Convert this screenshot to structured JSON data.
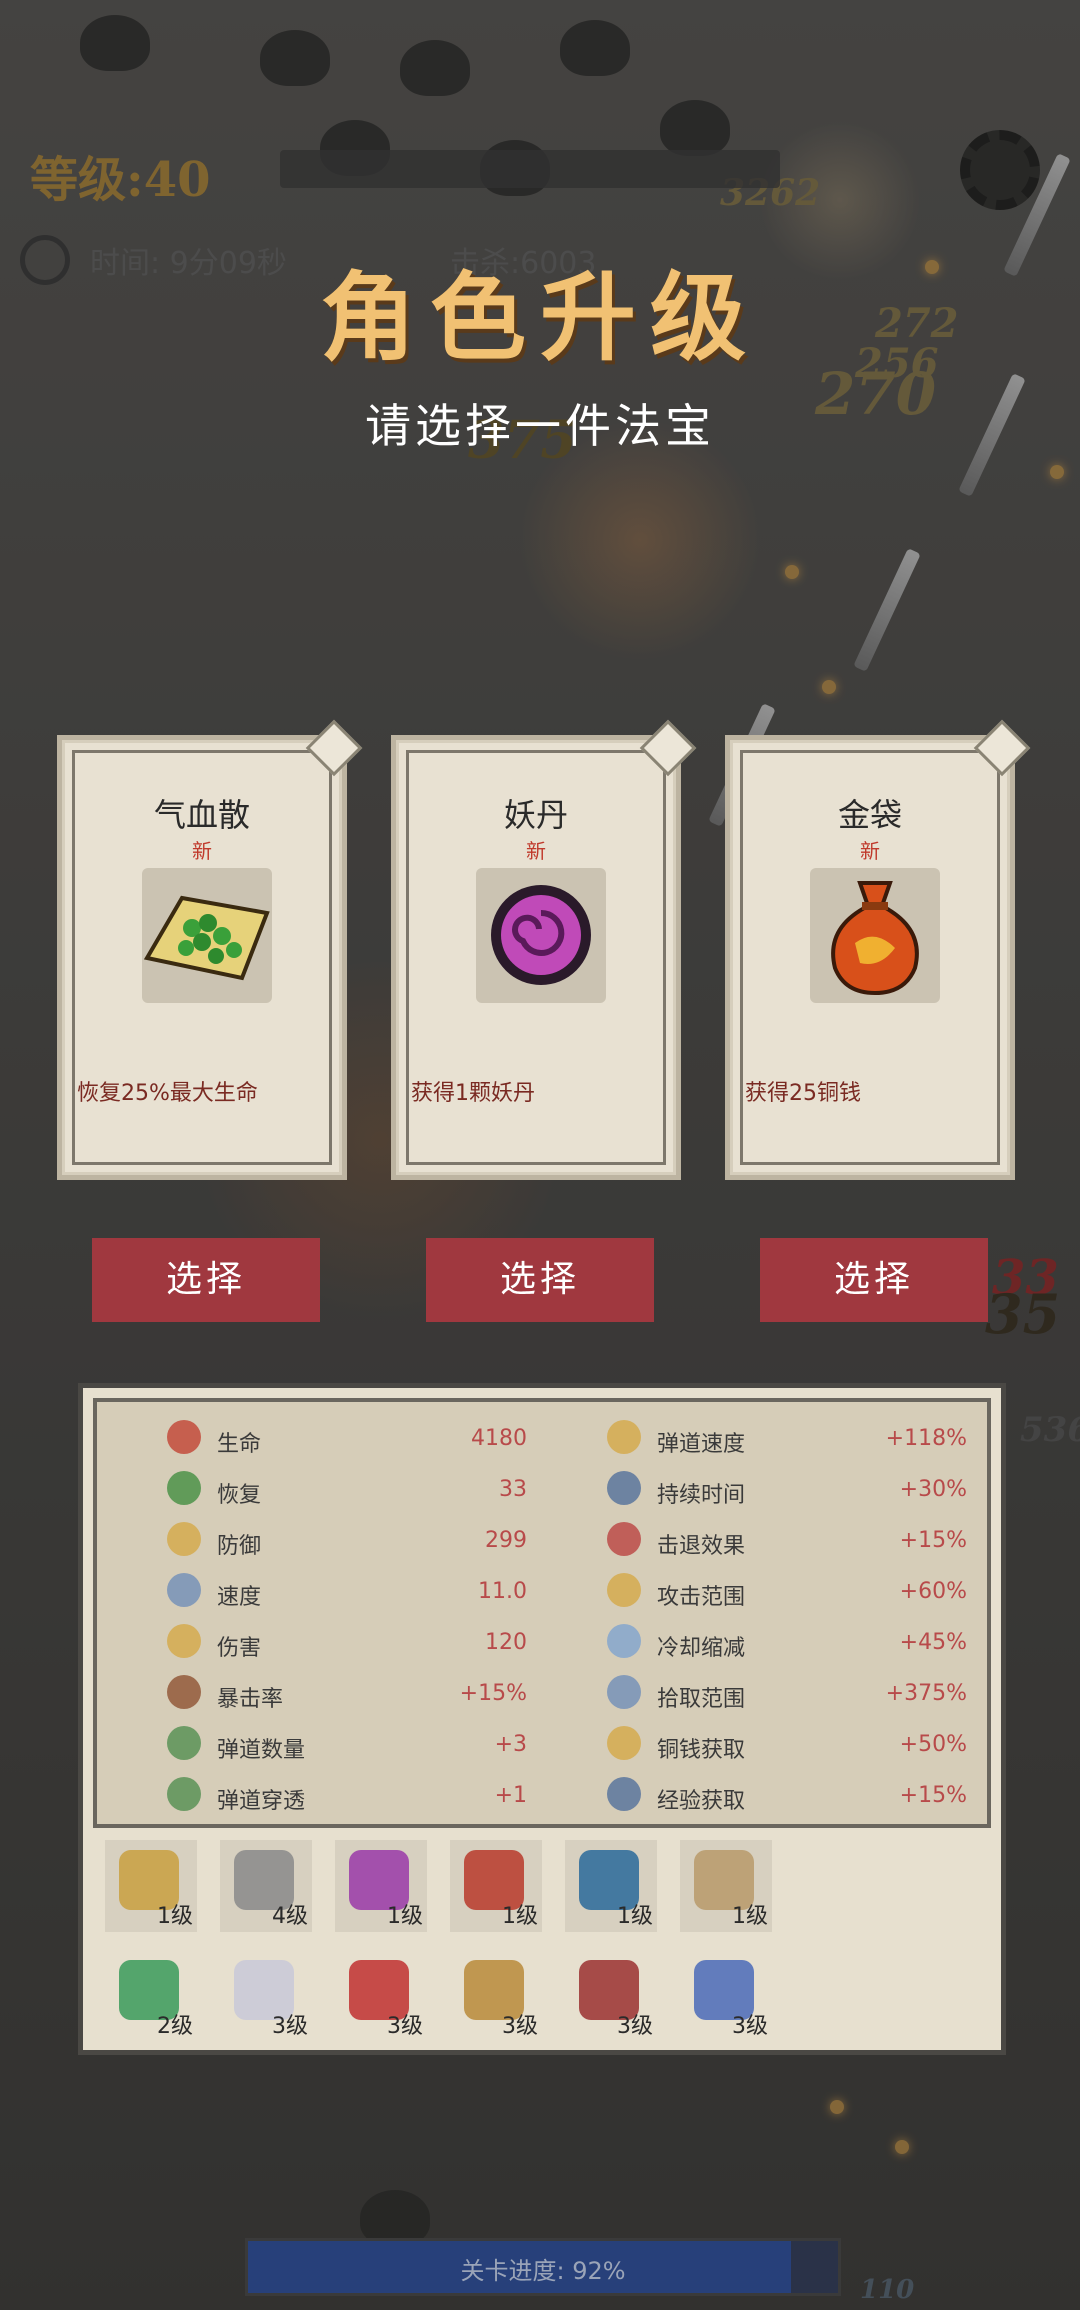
{
  "hud": {
    "level_text": "等级:40",
    "time_text": "时间:  9分09秒",
    "kills_text": "击杀:6003",
    "stage_progress_label": "关卡进度:",
    "stage_progress_value": "92%",
    "stage_progress_fraction": 0.92
  },
  "damage_numbers": [
    "3262",
    "272",
    "256",
    "270",
    "375",
    "33",
    "35",
    "536",
    "110"
  ],
  "dialog": {
    "title": "角色升级",
    "subtitle": "请选择一件法宝"
  },
  "cards": [
    {
      "name": "气血散",
      "badge": "新",
      "icon": "herb-pile-icon",
      "desc": "恢复25%最大生命",
      "button": "选择"
    },
    {
      "name": "妖丹",
      "badge": "新",
      "icon": "demon-core-icon",
      "desc": "获得1颗妖丹",
      "button": "选择"
    },
    {
      "name": "金袋",
      "badge": "新",
      "icon": "money-bag-icon",
      "desc": "获得25铜钱",
      "button": "选择"
    }
  ],
  "stats_left": [
    {
      "label": "生命",
      "value": "4180",
      "icon": "heart-icon",
      "color": "#c0392b"
    },
    {
      "label": "恢复",
      "value": "33",
      "icon": "heal-cross-icon",
      "color": "#3a8a3a"
    },
    {
      "label": "防御",
      "value": "299",
      "icon": "shield-buddha-icon",
      "color": "#d4a640"
    },
    {
      "label": "速度",
      "value": "11.0",
      "icon": "wind-icon",
      "color": "#6a8ab8"
    },
    {
      "label": "伤害",
      "value": "120",
      "icon": "fist-icon",
      "color": "#d4a640"
    },
    {
      "label": "暴击率",
      "value": "+15%",
      "icon": "shuriken-icon",
      "color": "#8a4a2a"
    },
    {
      "label": "弹道数量",
      "value": "+3",
      "icon": "arrows-icon",
      "color": "#4a8a4a"
    },
    {
      "label": "弹道穿透",
      "value": "+1",
      "icon": "pierce-icon",
      "color": "#4a8a4a"
    }
  ],
  "stats_right": [
    {
      "label": "弹道速度",
      "value": "+118%",
      "icon": "comet-icon",
      "color": "#d4a640"
    },
    {
      "label": "持续时间",
      "value": "+30%",
      "icon": "hourglass-icon",
      "color": "#4a6a9a"
    },
    {
      "label": "击退效果",
      "value": "+15%",
      "icon": "punch-icon",
      "color": "#b83a3a"
    },
    {
      "label": "攻击范围",
      "value": "+60%",
      "icon": "target-icon",
      "color": "#d4a640"
    },
    {
      "label": "冷却缩减",
      "value": "+45%",
      "icon": "snowflake-icon",
      "color": "#7aa0d0"
    },
    {
      "label": "拾取范围",
      "value": "+375%",
      "icon": "magnet-hand-icon",
      "color": "#6a8ab8"
    },
    {
      "label": "铜钱获取",
      "value": "+50%",
      "icon": "coins-icon",
      "color": "#d4a640"
    },
    {
      "label": "经验获取",
      "value": "+15%",
      "icon": "scroll-icon",
      "color": "#4a6a9a"
    }
  ],
  "weapons": [
    {
      "icon": "dagger-icon",
      "level": "1级",
      "color": "#c9a040"
    },
    {
      "icon": "sword-icon",
      "level": "4级",
      "color": "#8a8a8a"
    },
    {
      "icon": "purple-sword-icon",
      "level": "1级",
      "color": "#9a3aa8"
    },
    {
      "icon": "flute-icon",
      "level": "1级",
      "color": "#b83a2a"
    },
    {
      "icon": "yin-yang-icon",
      "level": "1级",
      "color": "#2a6a9a"
    },
    {
      "icon": "bow-icon",
      "level": "1级",
      "color": "#b89a6a"
    }
  ],
  "passives": [
    {
      "icon": "jade-ring-icon",
      "level": "2级",
      "color": "#3a9a5a"
    },
    {
      "icon": "feather-fan-icon",
      "level": "3级",
      "color": "#c8c8d8"
    },
    {
      "icon": "potion-icon",
      "level": "3级",
      "color": "#c03030"
    },
    {
      "icon": "pouch-icon",
      "level": "3级",
      "color": "#b88a3a"
    },
    {
      "icon": "scroll-blade-icon",
      "level": "3级",
      "color": "#9a3030"
    },
    {
      "icon": "crystal-icon",
      "level": "3级",
      "color": "#4a6ab8"
    }
  ]
}
